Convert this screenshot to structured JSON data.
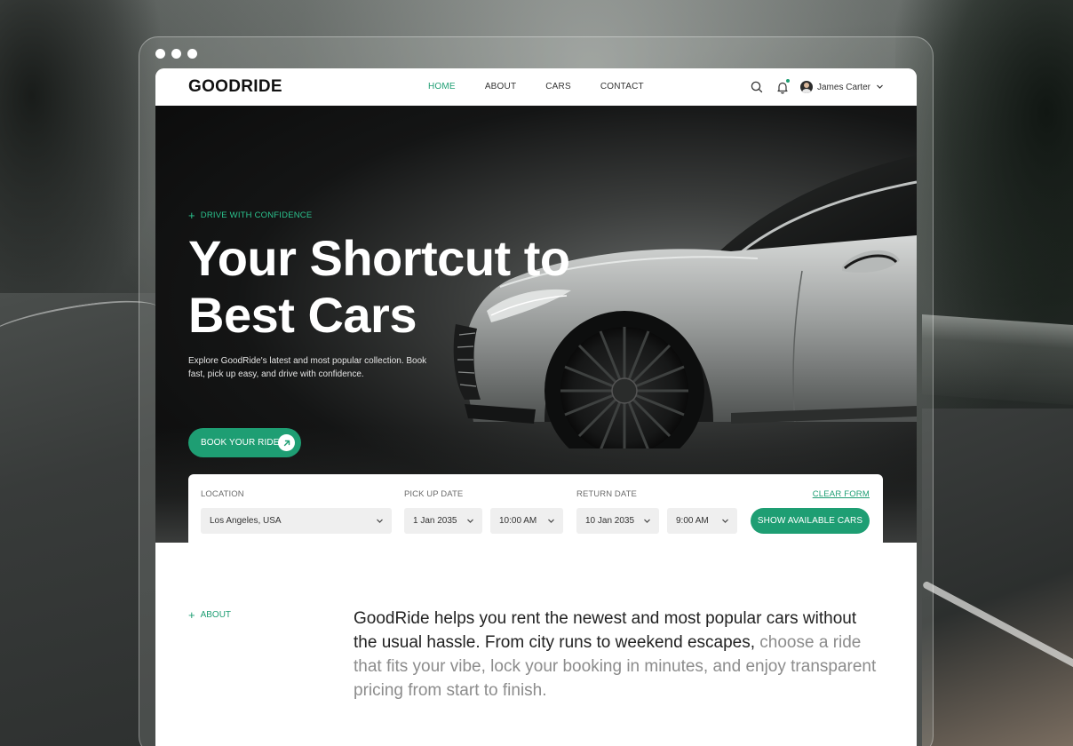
{
  "nav": {
    "logo": "GOODRIDE",
    "menu": [
      {
        "label": "HOME",
        "active": true
      },
      {
        "label": "ABOUT",
        "active": false
      },
      {
        "label": "CARS",
        "active": false
      },
      {
        "label": "CONTACT",
        "active": false
      }
    ],
    "search_icon": "search-icon",
    "notification_icon": "bell-icon",
    "user": {
      "name": "James Carter"
    }
  },
  "hero": {
    "eyebrow": "DRIVE WITH CONFIDENCE",
    "title_line1": "Your Shortcut to",
    "title_line2": "Best Cars",
    "description": "Explore GoodRide's latest and most popular collection. Book fast, pick up easy, and drive with confidence.",
    "cta_label": "BOOK YOUR RIDE"
  },
  "booking": {
    "location_label": "LOCATION",
    "location_value": "Los Angeles, USA",
    "pickup_label": "PICK UP DATE",
    "pickup_date": "1 Jan 2035",
    "pickup_time": "10:00 AM",
    "return_label": "RETURN DATE",
    "return_date": "10 Jan 2035",
    "return_time": "9:00 AM",
    "clear_label": "CLEAR FORM",
    "submit_label": "SHOW AVAILABLE CARS"
  },
  "about": {
    "tag": "ABOUT",
    "text_primary": "GoodRide helps you rent the newest and most popular cars without the usual hassle. From city runs to weekend escapes,",
    "text_muted": "choose a ride that fits your vibe, lock your booking in minutes, and enjoy transparent pricing from start to finish."
  },
  "colors": {
    "accent": "#1e9e73",
    "accent_light": "#2bc38e",
    "text_dark": "#222222",
    "text_muted": "#8c8c8c"
  }
}
